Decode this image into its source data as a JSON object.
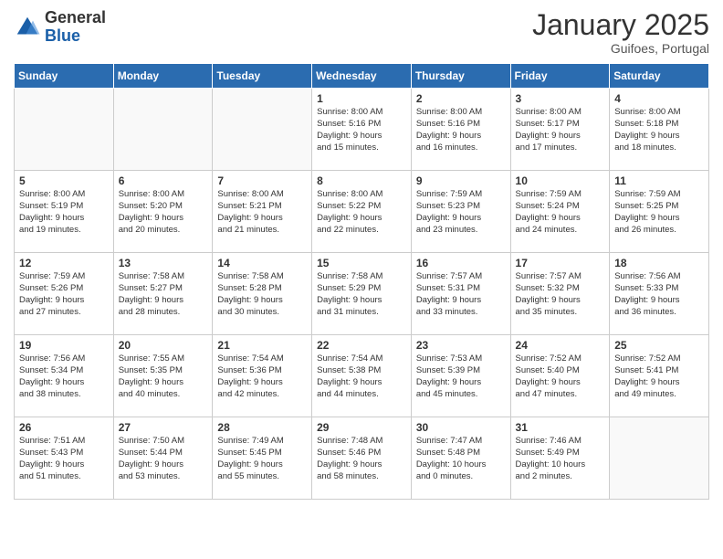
{
  "header": {
    "logo_general": "General",
    "logo_blue": "Blue",
    "month_title": "January 2025",
    "subtitle": "Guifoes, Portugal"
  },
  "days_of_week": [
    "Sunday",
    "Monday",
    "Tuesday",
    "Wednesday",
    "Thursday",
    "Friday",
    "Saturday"
  ],
  "weeks": [
    [
      {
        "day": null,
        "content": ""
      },
      {
        "day": null,
        "content": ""
      },
      {
        "day": null,
        "content": ""
      },
      {
        "day": "1",
        "content": "Sunrise: 8:00 AM\nSunset: 5:16 PM\nDaylight: 9 hours\nand 15 minutes."
      },
      {
        "day": "2",
        "content": "Sunrise: 8:00 AM\nSunset: 5:16 PM\nDaylight: 9 hours\nand 16 minutes."
      },
      {
        "day": "3",
        "content": "Sunrise: 8:00 AM\nSunset: 5:17 PM\nDaylight: 9 hours\nand 17 minutes."
      },
      {
        "day": "4",
        "content": "Sunrise: 8:00 AM\nSunset: 5:18 PM\nDaylight: 9 hours\nand 18 minutes."
      }
    ],
    [
      {
        "day": "5",
        "content": "Sunrise: 8:00 AM\nSunset: 5:19 PM\nDaylight: 9 hours\nand 19 minutes."
      },
      {
        "day": "6",
        "content": "Sunrise: 8:00 AM\nSunset: 5:20 PM\nDaylight: 9 hours\nand 20 minutes."
      },
      {
        "day": "7",
        "content": "Sunrise: 8:00 AM\nSunset: 5:21 PM\nDaylight: 9 hours\nand 21 minutes."
      },
      {
        "day": "8",
        "content": "Sunrise: 8:00 AM\nSunset: 5:22 PM\nDaylight: 9 hours\nand 22 minutes."
      },
      {
        "day": "9",
        "content": "Sunrise: 7:59 AM\nSunset: 5:23 PM\nDaylight: 9 hours\nand 23 minutes."
      },
      {
        "day": "10",
        "content": "Sunrise: 7:59 AM\nSunset: 5:24 PM\nDaylight: 9 hours\nand 24 minutes."
      },
      {
        "day": "11",
        "content": "Sunrise: 7:59 AM\nSunset: 5:25 PM\nDaylight: 9 hours\nand 26 minutes."
      }
    ],
    [
      {
        "day": "12",
        "content": "Sunrise: 7:59 AM\nSunset: 5:26 PM\nDaylight: 9 hours\nand 27 minutes."
      },
      {
        "day": "13",
        "content": "Sunrise: 7:58 AM\nSunset: 5:27 PM\nDaylight: 9 hours\nand 28 minutes."
      },
      {
        "day": "14",
        "content": "Sunrise: 7:58 AM\nSunset: 5:28 PM\nDaylight: 9 hours\nand 30 minutes."
      },
      {
        "day": "15",
        "content": "Sunrise: 7:58 AM\nSunset: 5:29 PM\nDaylight: 9 hours\nand 31 minutes."
      },
      {
        "day": "16",
        "content": "Sunrise: 7:57 AM\nSunset: 5:31 PM\nDaylight: 9 hours\nand 33 minutes."
      },
      {
        "day": "17",
        "content": "Sunrise: 7:57 AM\nSunset: 5:32 PM\nDaylight: 9 hours\nand 35 minutes."
      },
      {
        "day": "18",
        "content": "Sunrise: 7:56 AM\nSunset: 5:33 PM\nDaylight: 9 hours\nand 36 minutes."
      }
    ],
    [
      {
        "day": "19",
        "content": "Sunrise: 7:56 AM\nSunset: 5:34 PM\nDaylight: 9 hours\nand 38 minutes."
      },
      {
        "day": "20",
        "content": "Sunrise: 7:55 AM\nSunset: 5:35 PM\nDaylight: 9 hours\nand 40 minutes."
      },
      {
        "day": "21",
        "content": "Sunrise: 7:54 AM\nSunset: 5:36 PM\nDaylight: 9 hours\nand 42 minutes."
      },
      {
        "day": "22",
        "content": "Sunrise: 7:54 AM\nSunset: 5:38 PM\nDaylight: 9 hours\nand 44 minutes."
      },
      {
        "day": "23",
        "content": "Sunrise: 7:53 AM\nSunset: 5:39 PM\nDaylight: 9 hours\nand 45 minutes."
      },
      {
        "day": "24",
        "content": "Sunrise: 7:52 AM\nSunset: 5:40 PM\nDaylight: 9 hours\nand 47 minutes."
      },
      {
        "day": "25",
        "content": "Sunrise: 7:52 AM\nSunset: 5:41 PM\nDaylight: 9 hours\nand 49 minutes."
      }
    ],
    [
      {
        "day": "26",
        "content": "Sunrise: 7:51 AM\nSunset: 5:43 PM\nDaylight: 9 hours\nand 51 minutes."
      },
      {
        "day": "27",
        "content": "Sunrise: 7:50 AM\nSunset: 5:44 PM\nDaylight: 9 hours\nand 53 minutes."
      },
      {
        "day": "28",
        "content": "Sunrise: 7:49 AM\nSunset: 5:45 PM\nDaylight: 9 hours\nand 55 minutes."
      },
      {
        "day": "29",
        "content": "Sunrise: 7:48 AM\nSunset: 5:46 PM\nDaylight: 9 hours\nand 58 minutes."
      },
      {
        "day": "30",
        "content": "Sunrise: 7:47 AM\nSunset: 5:48 PM\nDaylight: 10 hours\nand 0 minutes."
      },
      {
        "day": "31",
        "content": "Sunrise: 7:46 AM\nSunset: 5:49 PM\nDaylight: 10 hours\nand 2 minutes."
      },
      {
        "day": null,
        "content": ""
      }
    ]
  ]
}
